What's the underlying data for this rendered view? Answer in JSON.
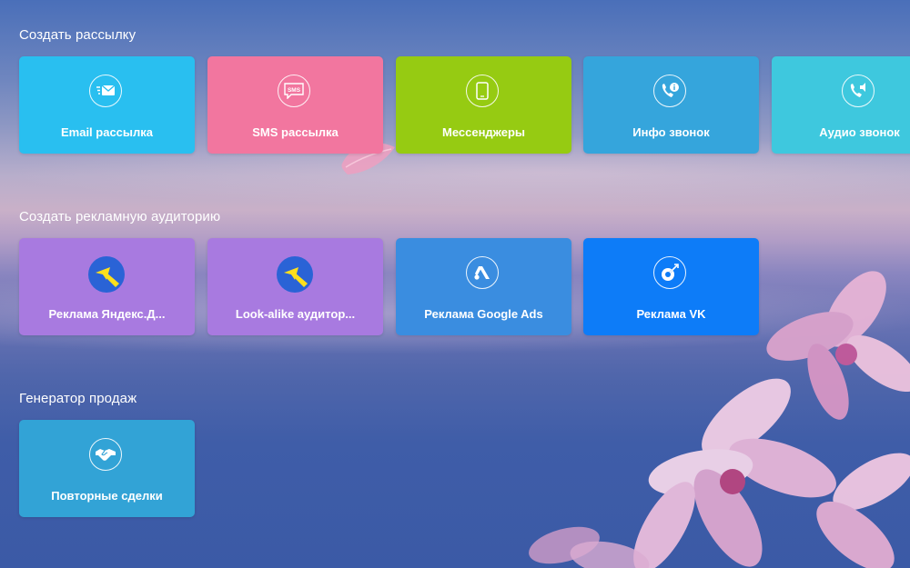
{
  "sections": [
    {
      "title": "Создать рассылку",
      "tiles": [
        {
          "label": "Email рассылка",
          "icon": "email-icon",
          "color": "#29bff0"
        },
        {
          "label": "SMS рассылка",
          "icon": "sms-icon",
          "color": "#f2769f"
        },
        {
          "label": "Мессенджеры",
          "icon": "smartphone-icon",
          "color": "#96cb12"
        },
        {
          "label": "Инфо звонок",
          "icon": "info-call-icon",
          "color": "#35a5dc"
        },
        {
          "label": "Аудио звонок",
          "icon": "audio-call-icon",
          "color": "#3ec8de"
        }
      ]
    },
    {
      "title": "Создать рекламную аудиторию",
      "tiles": [
        {
          "label": "Реклама Яндекс.Д...",
          "icon": "yandex-direct-icon",
          "color": "#a87ae0"
        },
        {
          "label": "Look-alike аудитор...",
          "icon": "yandex-direct-icon",
          "color": "#a87ae0"
        },
        {
          "label": "Реклама Google Ads",
          "icon": "google-ads-icon",
          "color": "#3a8de0"
        },
        {
          "label": "Реклама VK",
          "icon": "vk-ads-icon",
          "color": "#0d7cf8"
        }
      ]
    },
    {
      "title": "Генератор продаж",
      "tiles": [
        {
          "label": "Повторные сделки",
          "icon": "handshake-icon",
          "color": "#32a3d6"
        }
      ]
    }
  ]
}
